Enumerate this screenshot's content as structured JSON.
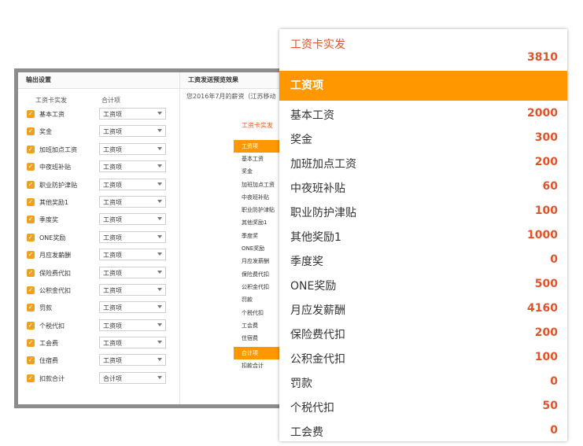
{
  "left_panel": {
    "title": "输出设置",
    "col1": "工资卡实发",
    "col2": "合计项",
    "rows": [
      {
        "label": "基本工资",
        "select": "工资项"
      },
      {
        "label": "奖金",
        "select": "工资项"
      },
      {
        "label": "加班加点工资",
        "select": "工资项"
      },
      {
        "label": "中夜班补贴",
        "select": "工资项"
      },
      {
        "label": "职业防护津贴",
        "select": "工资项"
      },
      {
        "label": "其他奖励1",
        "select": "工资项"
      },
      {
        "label": "季度奖",
        "select": "工资项"
      },
      {
        "label": "ONE奖励",
        "select": "工资项"
      },
      {
        "label": "月应发薪酬",
        "select": "工资项"
      },
      {
        "label": "保险费代扣",
        "select": "工资项"
      },
      {
        "label": "公积金代扣",
        "select": "工资项"
      },
      {
        "label": "罚款",
        "select": "工资项"
      },
      {
        "label": "个税代扣",
        "select": "工资项"
      },
      {
        "label": "工会费",
        "select": "工资项"
      },
      {
        "label": "住宿费",
        "select": "工资项"
      },
      {
        "label": "扣款合计",
        "select": "合计项"
      }
    ]
  },
  "right_panel": {
    "title": "工资发送预览效果",
    "subtitle": "您2016年7月的薪资（江苏移动",
    "mini_title": "工资卡实发",
    "mini_band": "工资项",
    "mini_items": [
      "基本工资",
      "奖金",
      "加班加点工资",
      "中夜班补贴",
      "职业防护津贴",
      "其他奖励1",
      "季度奖",
      "ONE奖励",
      "月应发薪酬",
      "保险费代扣",
      "公积金代扣",
      "罚款",
      "个税代扣",
      "工会费",
      "住宿费"
    ],
    "mini_band2": "合计项",
    "mini_last": "扣款合计"
  },
  "card": {
    "title": "工资卡实发",
    "total": "3810",
    "band": "工资项",
    "items": [
      {
        "name": "基本工资",
        "amount": "2000"
      },
      {
        "name": "奖金",
        "amount": "300"
      },
      {
        "name": "加班加点工资",
        "amount": "200"
      },
      {
        "name": "中夜班补贴",
        "amount": "60"
      },
      {
        "name": "职业防护津贴",
        "amount": "100"
      },
      {
        "name": "其他奖励1",
        "amount": "1000"
      },
      {
        "name": "季度奖",
        "amount": "0"
      },
      {
        "name": "ONE奖励",
        "amount": "500"
      },
      {
        "name": "月应发薪酬",
        "amount": "4160"
      },
      {
        "name": "保险费代扣",
        "amount": "200"
      },
      {
        "name": "公积金代扣",
        "amount": "100"
      },
      {
        "name": "罚款",
        "amount": "0"
      },
      {
        "name": "个税代扣",
        "amount": "50"
      },
      {
        "name": "工会费",
        "amount": "0"
      }
    ]
  },
  "colors": {
    "accent": "#ff9800",
    "amount": "#e0532a",
    "checkbox": "#f0a020"
  }
}
